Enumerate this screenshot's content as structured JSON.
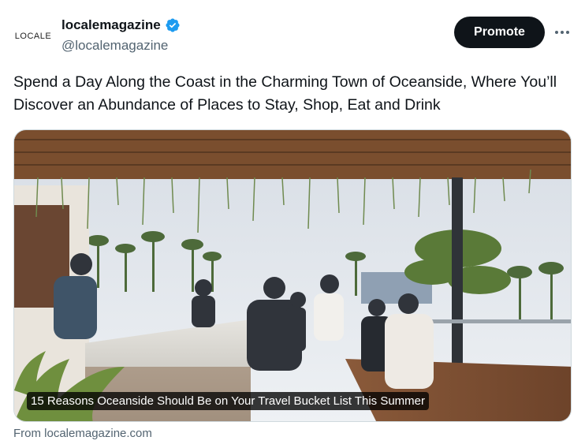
{
  "account": {
    "avatar_text": "LOCALE",
    "display_name": "localemagazine",
    "handle": "@localemagazine",
    "verified_icon": "verified-badge-icon",
    "verified_color": "#1d9bf0"
  },
  "actions": {
    "promote_label": "Promote",
    "more_icon": "more-dots-icon"
  },
  "tweet": {
    "text": "Spend a Day Along the Coast in the Charming Town of Oceanside, Where You’ll Discover an Abundance of Places to Stay, Shop, Eat and Drink"
  },
  "card": {
    "caption": "15 Reasons Oceanside Should Be on Your Travel Bucket List This Summer",
    "source": "From localemagazine.com"
  },
  "colors": {
    "accent": "#0f1419",
    "secondary_text": "#536471"
  }
}
